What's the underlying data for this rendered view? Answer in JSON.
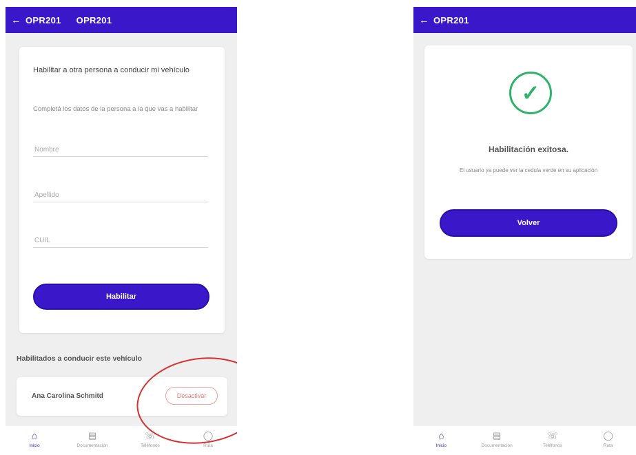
{
  "left_screen": {
    "header": {
      "back_icon": "arrow-left-icon",
      "plate_1": "OPR201",
      "plate_2": "OPR201"
    },
    "form": {
      "title": "Habilitar a otra persona a conducir mi vehículo",
      "subtitle": "Completá los datos de la persona a la que vas a habilitar",
      "nombre_placeholder": "Nombre",
      "apellido_placeholder": "Apellido",
      "cuil_placeholder": "CUIL",
      "submit_label": "Habilitar"
    },
    "authorized_section": {
      "title": "Habilitados a conducir este vehículo",
      "drivers": [
        {
          "name": "Ana Carolina Schmitd",
          "action_label": "Desactivar"
        }
      ]
    },
    "tabbar": [
      {
        "icon": "home-icon",
        "label": "Inicio",
        "active": true
      },
      {
        "icon": "document-icon",
        "label": "Documentación",
        "active": false
      },
      {
        "icon": "phone-icon",
        "label": "Teléfonos",
        "active": false
      },
      {
        "icon": "helmet-icon",
        "label": "Ruta",
        "active": false
      }
    ]
  },
  "right_screen": {
    "header": {
      "back_icon": "arrow-left-icon",
      "plate": "OPR201"
    },
    "success": {
      "icon": "check-circle-icon",
      "title": "Habilitación exitosa.",
      "text": "El usuario ya puede ver la cedula verde en su aplicación",
      "button_label": "Volver"
    },
    "tabbar": [
      {
        "icon": "home-icon",
        "label": "Inicio",
        "active": true
      },
      {
        "icon": "document-icon",
        "label": "Documentación",
        "active": false
      },
      {
        "icon": "phone-icon",
        "label": "Teléfonos",
        "active": false
      },
      {
        "icon": "helmet-icon",
        "label": "Ruta",
        "active": false
      }
    ]
  },
  "colors": {
    "brand": "#3a17c8",
    "success": "#2fb36a",
    "annotation": "#d93030",
    "background": "#efefef"
  }
}
